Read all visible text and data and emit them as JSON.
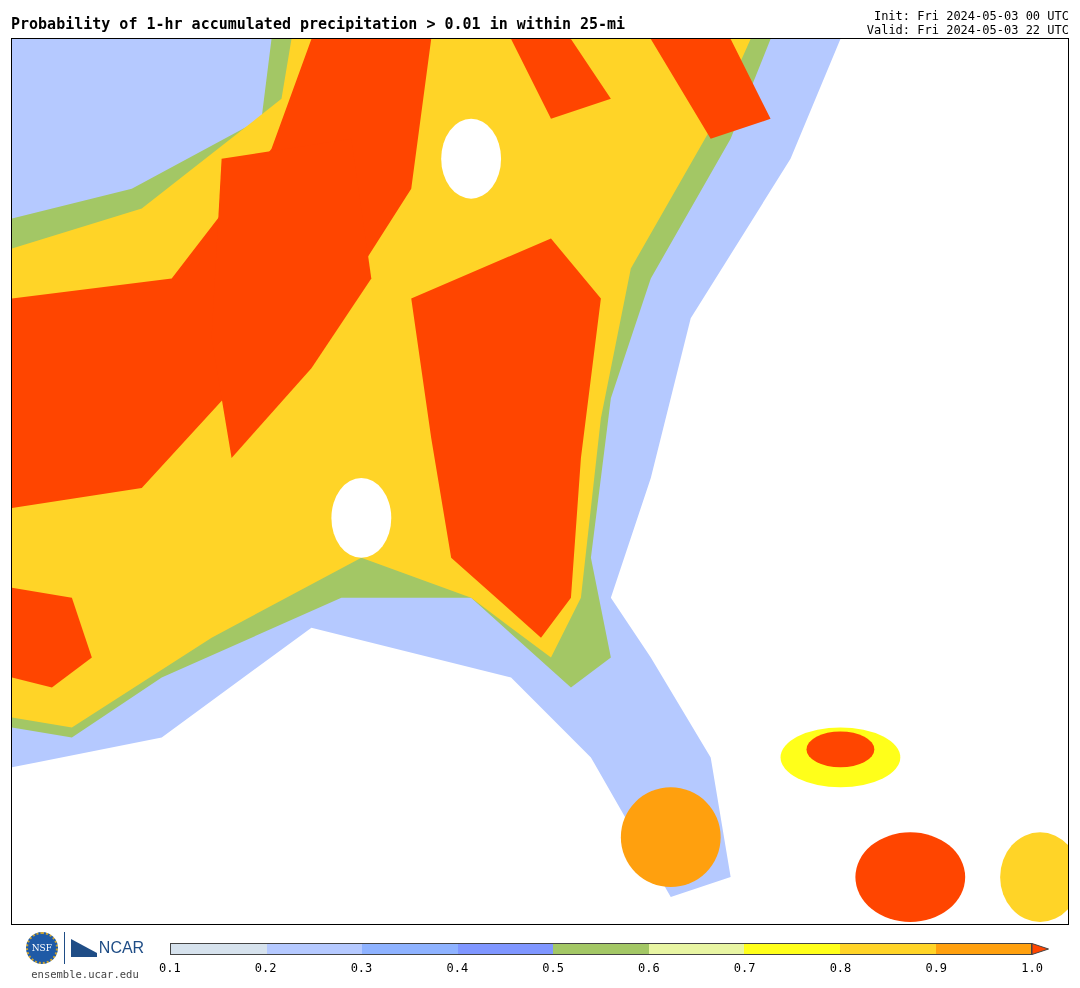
{
  "title": "Probability of 1-hr accumulated precipitation > 0.01 in within 25-mi",
  "init": "Init: Fri 2024-05-03 00 UTC",
  "valid": "Valid: Fri 2024-05-03 22 UTC",
  "logos": {
    "nsf": "NSF",
    "ncar": "NCAR",
    "url": "ensemble.ucar.edu"
  },
  "colorbar": {
    "segments": [
      {
        "color": "#d6e2ed"
      },
      {
        "color": "#b5c9ff"
      },
      {
        "color": "#8eb2ff"
      },
      {
        "color": "#7f96ff"
      },
      {
        "color": "#a3c765"
      },
      {
        "color": "#e8f5a3"
      },
      {
        "color": "#ffff1a"
      },
      {
        "color": "#ffd427"
      },
      {
        "color": "#ffa00e"
      },
      {
        "color": "#ff4500",
        "kind": "extend"
      }
    ],
    "ticks": [
      "0.1",
      "0.2",
      "0.3",
      "0.4",
      "0.5",
      "0.6",
      "0.7",
      "0.8",
      "0.9",
      "1.0"
    ]
  }
}
